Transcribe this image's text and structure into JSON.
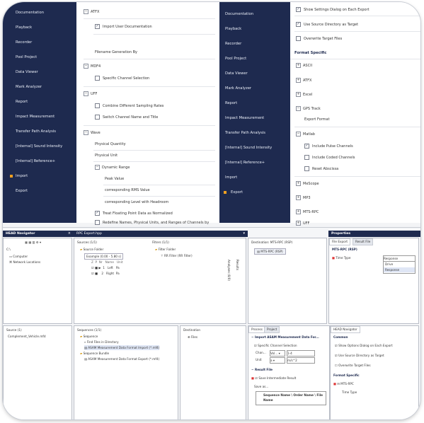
{
  "nav_left": {
    "items": [
      "Documentation",
      "Playback",
      "Recorder",
      "Pool Project",
      "Data Viewer",
      "Mark Analyzer",
      "Report",
      "Impact Measurement",
      "Transfer Path Analysis",
      "[Internal] Sound Intensity",
      "[Internal] Reference+",
      "Import",
      "Export"
    ],
    "active": "Import"
  },
  "nav_right": {
    "items": [
      "Documentation",
      "Playback",
      "Recorder",
      "Pool Project",
      "Data Viewer",
      "Mark Analyzer",
      "Report",
      "Impact Measurement",
      "Transfer Path Analysis",
      "[Internal] Sound Intensity",
      "[Internal] Reference+",
      "Import",
      "Export"
    ],
    "active": "Export"
  },
  "import_settings": {
    "atfx": "ATFX",
    "import_user_doc": "Import User Documentation",
    "filename_generation": "Filename Generation By",
    "mdf4": "MDF4",
    "specific_channel": "Specific Channel Selection",
    "uff": "UFF",
    "combine_rates": "Combine Different Sampling Rates",
    "switch_channel": "Switch Channel Name and Title",
    "wave": "Wave",
    "physical_quantity": "Physical Quantity",
    "physical_unit": "Physical Unit",
    "dynamic_range": "Dynamic Range",
    "peak_value": "Peak Value",
    "rms_value": "corresponding RMS Value",
    "level_headroom": "corresponding Level with Headroom",
    "treat_float": "Treat Floating Point Data as Normalized",
    "redefine_names": "Redefine Names, Physical Units, and Ranges of Channels by"
  },
  "export_settings": {
    "show_settings": "Show Settings Dialog on Each Export",
    "use_source_dir": "Use Source Directory as Target",
    "overwrite": "Overwrite Target Files",
    "format_specific": "Format Specific",
    "formats": [
      "ASCII",
      "ATFX",
      "Excel",
      "GPS Track"
    ],
    "export_format": "Export Format",
    "matlab": "Matlab",
    "include_pulse": "Include Pulse Channels",
    "include_coded": "Include Coded Channels",
    "reset_abscissa": "Reset Abscissa",
    "formats2": [
      "MeScope",
      "MP3",
      "MTS-RPC",
      "UFF"
    ]
  },
  "bottom": {
    "head_navigator": "HEAD Navigator",
    "tree_root": "C:\\",
    "computer": "Computer",
    "network": "Network Locations",
    "rpc_tab": "RPC Export.hpp",
    "sources_title": "Sources (1/1)",
    "source_folder": "Source Folder",
    "example_file": "Example (0.00 - 5.80 s)",
    "col_hdrs": [
      "Z",
      "P",
      "Nr",
      "Name",
      "Unit"
    ],
    "channel_rows": [
      [
        "1",
        "Left",
        "Pa"
      ],
      [
        "2",
        "Right",
        "Pa"
      ]
    ],
    "filters_title": "Filters (1/1)",
    "filter_folder": "Filter Folder",
    "rr_filter": "RR Filter (RR Filter)",
    "analyses": "Analyses (0/0)",
    "results": "Results",
    "destination_title": "Destination: MTS-RPC (RSP)",
    "dest_item": "MTS-RPC (RSP)",
    "properties": "Properties",
    "prop_tab1": "File Export",
    "prop_tab2": "Result File",
    "prop_section": "MTS-RPC (RSP)",
    "time_type": "Time Type",
    "time_type_value": "Response",
    "dropdown_options": [
      "Drive",
      "Response"
    ],
    "source_title": "Source (1)",
    "source_item": "Complement_Vehicle.mfd",
    "sequences_title": "Sequences (1/1)",
    "sequence": "Sequence",
    "seq_items": [
      "Find Files in Directory",
      "ASAM Measurement Data Format Import (*.mf4)",
      "Sequence Bundle",
      "ASAM Measurement Data Format Export (*.mf4)"
    ],
    "destination2": "Destination",
    "files": "Files",
    "process_tab": "Process",
    "project_tab": "Project",
    "import_asam": "Import ASAM Measurement Data For...",
    "specific_channel": "Specific Channel Selection",
    "chan_label": "Chan...",
    "chan_dd": "Vol...",
    "chan_range": "1-4",
    "unit_label": "Unit",
    "unit_dd": "a",
    "unit_val": "m/s^2",
    "result_file": "Result File",
    "save_intermediate": "Save Intermediate Result",
    "save_as": "Save as...",
    "save_pattern": "Sequence Name \\ Order Name \\ File Name",
    "head_nav_tab": "HEAD Navigator",
    "common": "Common",
    "show_options": "Show Options Dialog on Each Export",
    "use_source": "Use Source Directory as Target",
    "overwrite": "Overwrite Target Files",
    "format_specific": "Format Specific",
    "mts_rpc": "MTS-RPC",
    "time_type2": "Time Type"
  },
  "colors": {
    "nav_bg": "#1e2a4f",
    "accent": "#f0a020",
    "header_bg": "#1e2a4f"
  }
}
